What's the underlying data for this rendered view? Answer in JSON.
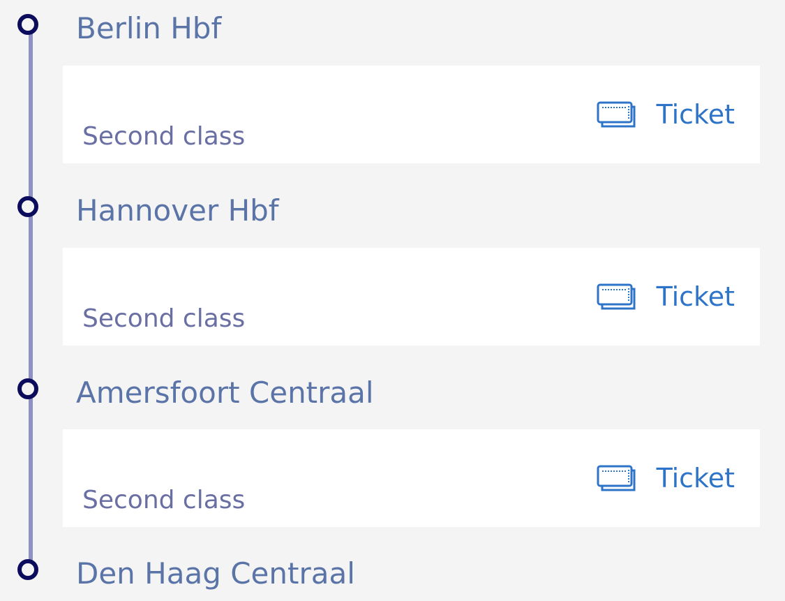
{
  "journey": {
    "stops": [
      {
        "name": "Berlin Hbf"
      },
      {
        "name": "Hannover Hbf"
      },
      {
        "name": "Amersfoort Centraal"
      },
      {
        "name": "Den Haag Centraal"
      }
    ],
    "legs": [
      {
        "class": "Second class",
        "ticket_label": "Ticket"
      },
      {
        "class": "Second class",
        "ticket_label": "Ticket"
      },
      {
        "class": "Second class",
        "ticket_label": "Ticket"
      }
    ]
  },
  "icons": {
    "stop_marker": "circle-marker",
    "ticket": "ticket-icon"
  },
  "colors": {
    "background": "#f4f4f4",
    "card_background": "#ffffff",
    "stop_text": "#5a74a8",
    "timeline_line": "#8e91c4",
    "stop_marker_border": "#0c0c5c",
    "class_text": "#6a6fa3",
    "ticket_blue": "#2d74c8"
  }
}
